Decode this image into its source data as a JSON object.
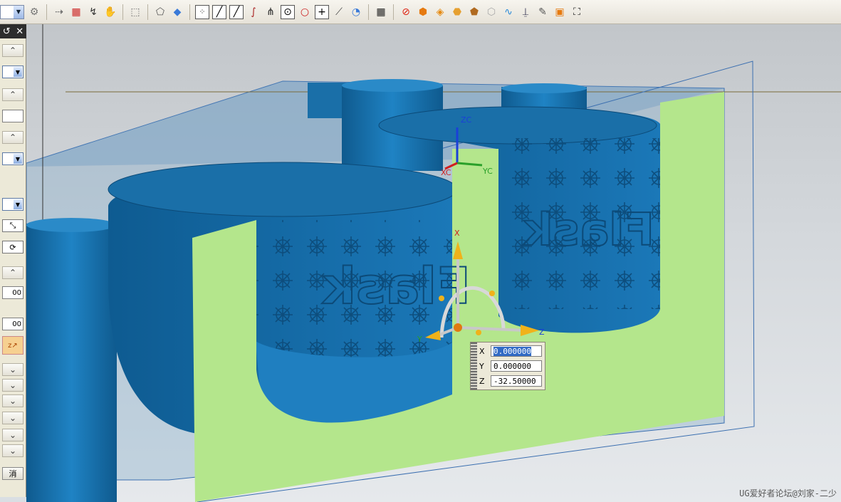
{
  "toolbar": {
    "icons": [
      "filter-icon",
      "snap-point-icon",
      "arrow-select-icon",
      "hand-icon",
      "rectangle-select-icon",
      "solid-icon",
      "shaded-box-icon",
      "grid-points-icon",
      "line-icon",
      "arc-icon",
      "curve-icon",
      "intersect-icon",
      "center-icon",
      "circle-icon",
      "plus-icon",
      "slash-icon",
      "inspect-icon",
      "matrix-icon",
      "no-entry-icon",
      "orange-cube-icon",
      "orange-face-icon",
      "layer-icon",
      "stack-icon",
      "white-box-icon",
      "spline-icon",
      "pin-icon",
      "sheet-icon",
      "small-cube-icon",
      "crop-icon"
    ]
  },
  "panel": {
    "header": {
      "reset": "↺",
      "close": "✕"
    },
    "field_a": "00",
    "field_b": "00",
    "button_bottom": "消"
  },
  "viewport": {
    "axis_labels": {
      "zc": "ZC",
      "xc": "XC",
      "yc": "YC",
      "x": "X",
      "y": "Y",
      "z": "Z"
    },
    "emboss_text": "Flask"
  },
  "coord_entry": {
    "x_label": "X",
    "x_value": "0.000000",
    "y_label": "Y",
    "y_value": "0.000000",
    "z_label": "Z",
    "z_value": "-32.50000"
  },
  "watermark": "UG爱好者论坛@刘家-二少",
  "colors": {
    "mold_blue": "#1a6fa8",
    "parting_green": "#b4e68c",
    "box_edge": "#3b6fb0"
  }
}
